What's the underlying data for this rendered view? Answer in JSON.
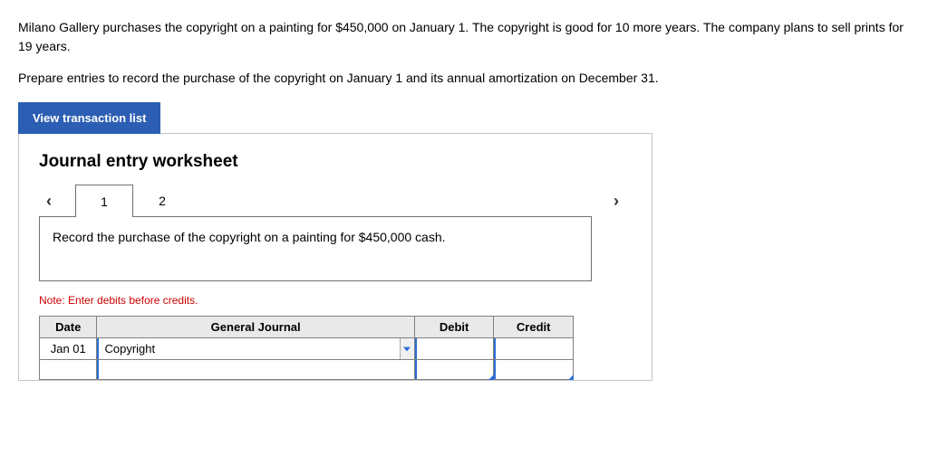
{
  "problem": {
    "p1": "Milano Gallery purchases the copyright on a painting for $450,000 on January 1. The copyright is good for 10 more years. The company plans to sell prints for 19 years.",
    "p2": "Prepare entries to record the purchase of the copyright on January 1 and its annual amortization on December 31."
  },
  "buttons": {
    "view_transactions": "View transaction list"
  },
  "worksheet": {
    "title": "Journal entry worksheet",
    "tabs": [
      "1",
      "2"
    ],
    "active_tab": 0,
    "instruction": "Record the purchase of the copyright on a painting for $450,000 cash.",
    "note": "Note: Enter debits before credits.",
    "table": {
      "headers": {
        "date": "Date",
        "gj": "General Journal",
        "debit": "Debit",
        "credit": "Credit"
      },
      "rows": [
        {
          "date": "Jan 01",
          "gj": "Copyright",
          "debit": "",
          "credit": ""
        },
        {
          "date": "",
          "gj": "",
          "debit": "",
          "credit": ""
        }
      ]
    }
  }
}
